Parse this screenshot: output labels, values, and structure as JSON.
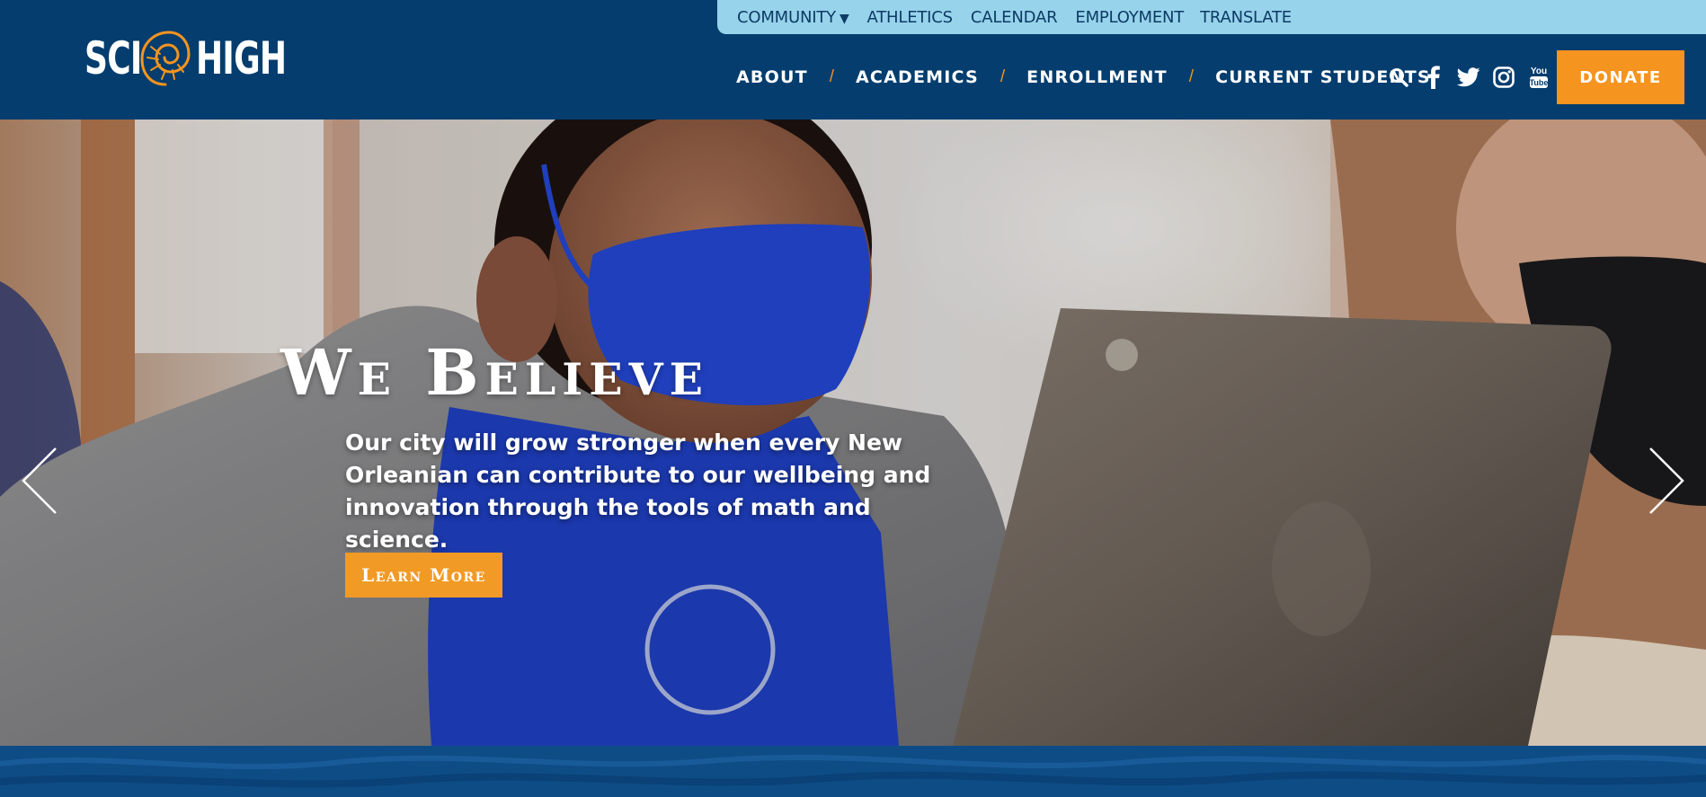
{
  "utility_nav": {
    "items": [
      "COMMUNITY",
      "ATHLETICS",
      "CALENDAR",
      "EMPLOYMENT"
    ],
    "community_caret": "▼",
    "translate": "TRANSLATE"
  },
  "logo": {
    "left_word": "SCI",
    "right_word": "HIGH"
  },
  "main_nav": {
    "items": [
      "ABOUT",
      "ACADEMICS",
      "ENROLLMENT",
      "CURRENT STUDENTS"
    ],
    "separator": "/"
  },
  "social": {
    "icons": [
      "search-icon",
      "facebook-icon",
      "twitter-icon",
      "instagram-icon",
      "youtube-icon"
    ]
  },
  "donate": {
    "label": "DONATE"
  },
  "hero": {
    "title": "We Believe",
    "text_lines": [
      "Our city will grow stronger when every New",
      "Orleanian can contribute to our wellbeing and",
      "innovation through the tools of math and science."
    ],
    "cta": "Learn More"
  },
  "colors": {
    "header_bg": "#043d6e",
    "utility_bg": "#97d3ea",
    "accent_orange": "#f5941f",
    "wave_blue": "#0e4c86"
  }
}
